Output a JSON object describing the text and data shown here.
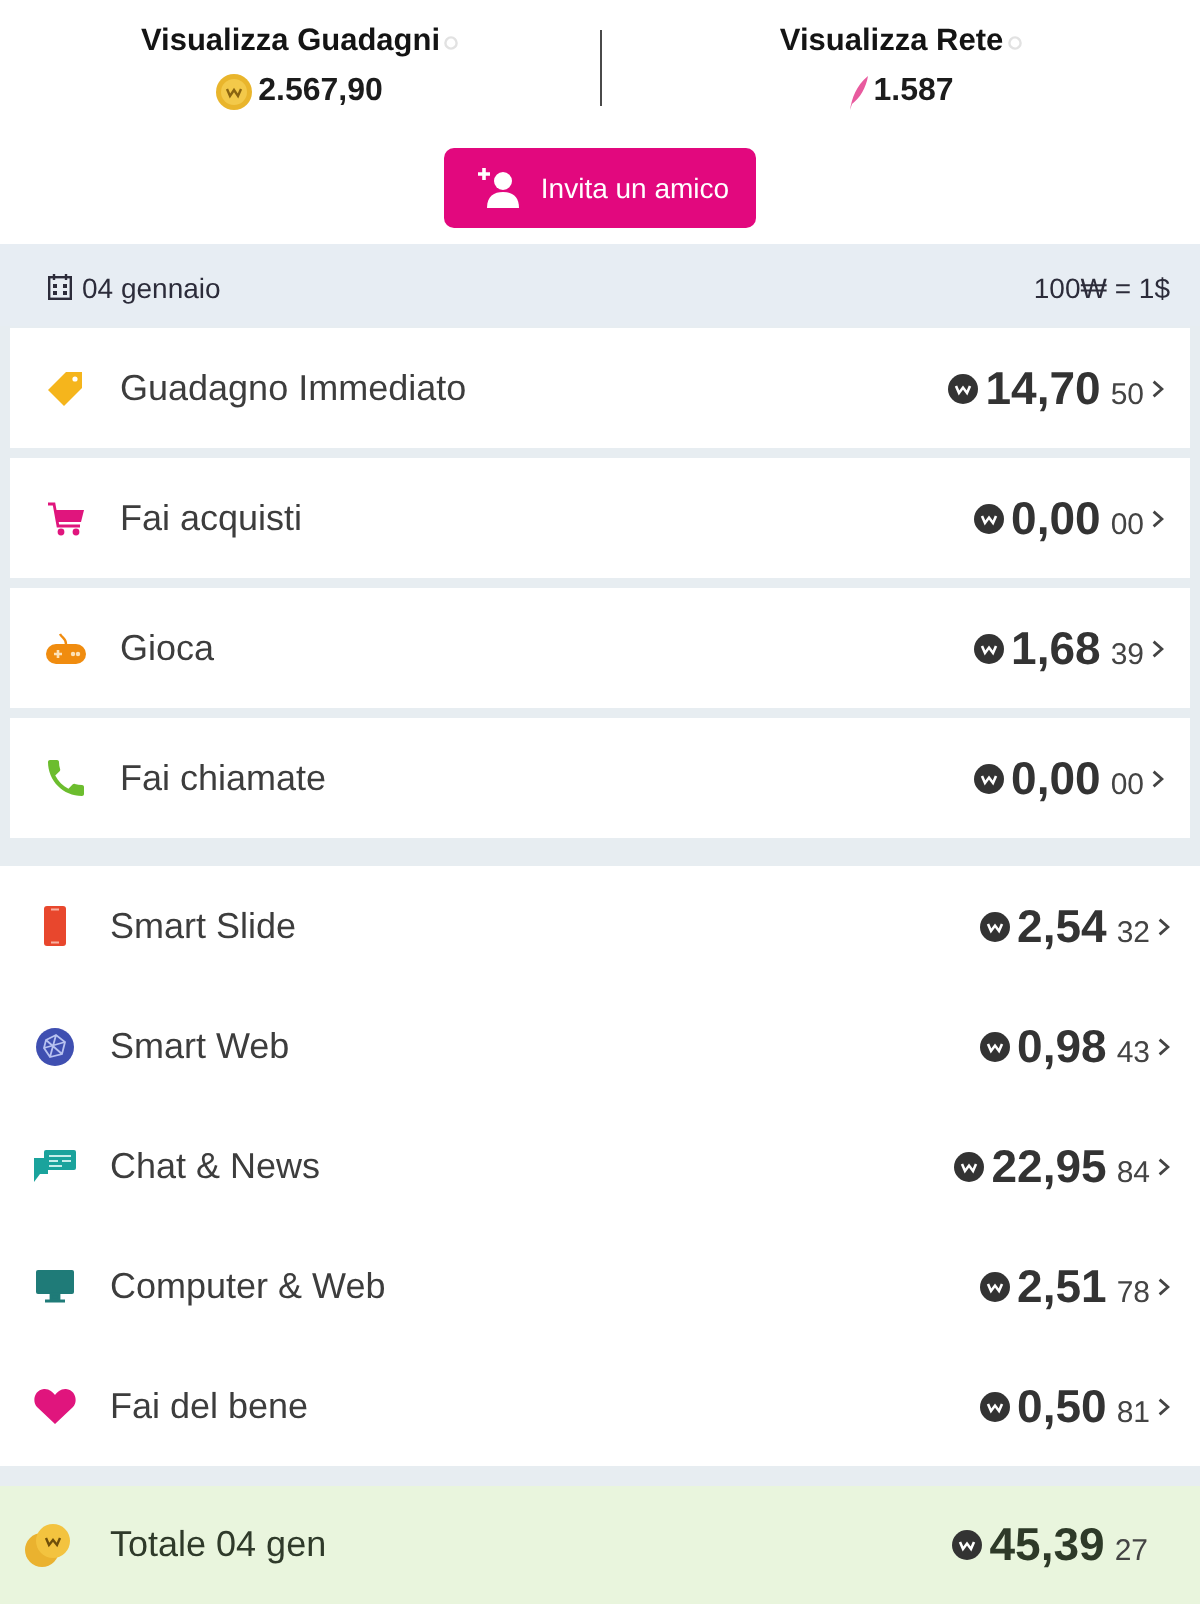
{
  "header": {
    "stats": [
      {
        "title": "Visualizza Guadagni",
        "value": "2.567,90"
      },
      {
        "title": "Visualizza Rete",
        "value": "1.587"
      }
    ],
    "invite_button": "Invita un amico"
  },
  "date_bar": {
    "date": "04 gennaio",
    "rate": "100₩ = 1$"
  },
  "cards": [
    {
      "label": "Guadagno Immediato",
      "amount": "14,70",
      "decimals": "50"
    },
    {
      "label": "Fai acquisti",
      "amount": "0,00",
      "decimals": "00"
    },
    {
      "label": "Gioca",
      "amount": "1,68",
      "decimals": "39"
    },
    {
      "label": "Fai chiamate",
      "amount": "0,00",
      "decimals": "00"
    }
  ],
  "categories": [
    {
      "label": "Smart Slide",
      "amount": "2,54",
      "decimals": "32"
    },
    {
      "label": "Smart Web",
      "amount": "0,98",
      "decimals": "43"
    },
    {
      "label": "Chat & News",
      "amount": "22,95",
      "decimals": "84"
    },
    {
      "label": "Computer & Web",
      "amount": "2,51",
      "decimals": "78"
    },
    {
      "label": "Fai del bene",
      "amount": "0,50",
      "decimals": "81"
    }
  ],
  "total": {
    "label": "Totale 04 gen",
    "amount": "45,39",
    "decimals": "27"
  }
}
